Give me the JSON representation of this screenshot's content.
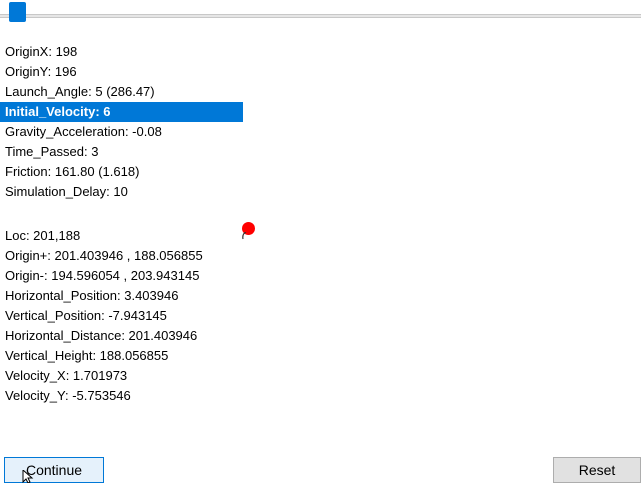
{
  "slider": {
    "position_fraction": 0.02
  },
  "parameters": [
    {
      "label": "OriginX: 198",
      "selected": false
    },
    {
      "label": "OriginY: 196",
      "selected": false
    },
    {
      "label": "Launch_Angle: 5  (286.47)",
      "selected": false
    },
    {
      "label": "Initial_Velocity: 6",
      "selected": true
    },
    {
      "label": "Gravity_Acceleration: -0.08",
      "selected": false
    },
    {
      "label": "Time_Passed: 3",
      "selected": false
    },
    {
      "label": "Friction: 161.80 (1.618)",
      "selected": false
    },
    {
      "label": "Simulation_Delay: 10",
      "selected": false
    }
  ],
  "readouts": [
    "Loc: 201,188",
    "Origin+: 201.403946 , 188.056855",
    "Origin-: 194.596054 , 203.943145",
    "Horizontal_Position: 3.403946",
    "Vertical_Position: -7.943145",
    "Horizontal_Distance: 201.403946",
    "Vertical_Height: 188.056855",
    "Velocity_X: 1.701973",
    "Velocity_Y: -5.753546"
  ],
  "buttons": {
    "continue_label": "Continue",
    "reset_label": "Reset"
  },
  "colors": {
    "selection": "#0078d7",
    "projectile": "#ff0000"
  }
}
